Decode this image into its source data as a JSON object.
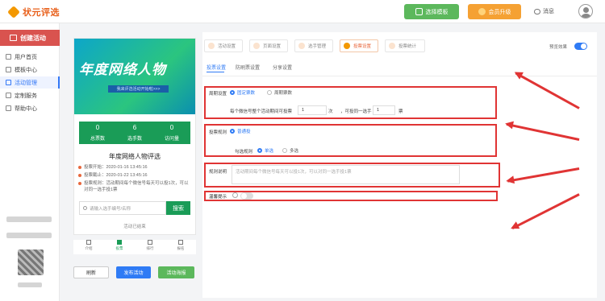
{
  "app": {
    "name": "状元评选"
  },
  "header": {
    "template_btn": "选择模板",
    "vip_btn": "会员升级",
    "messages": "消息"
  },
  "sidebar": {
    "create_btn": "创建活动",
    "items": [
      {
        "label": "用户首页"
      },
      {
        "label": "模板中心"
      },
      {
        "label": "活动管理"
      },
      {
        "label": "定制服务"
      },
      {
        "label": "帮助中心"
      }
    ],
    "active_index": 2
  },
  "phone": {
    "banner_title": "年度网络人物",
    "banner_sub": "我来评选活动开始啦>>>",
    "stats": [
      {
        "value": "0",
        "label": "总票数"
      },
      {
        "value": "6",
        "label": "选手数"
      },
      {
        "value": "0",
        "label": "访问量"
      }
    ],
    "activity_title": "年度网络人物评选",
    "rows": [
      {
        "text": "投票开始：2020-01-16 13:45:16"
      },
      {
        "text": "投票截止：2020-01-22 13:45:16"
      },
      {
        "text": "投票规则：活动期间每个微信号每天可以投1次，可以对同一选手投1票"
      }
    ],
    "search_placeholder": "请输入选手编号/名称",
    "search_btn": "搜索",
    "ended": "活动已结束",
    "tabs": [
      {
        "label": "介绍"
      },
      {
        "label": "投票"
      },
      {
        "label": "排行"
      },
      {
        "label": "报名"
      }
    ],
    "active_tab": 1
  },
  "footer": {
    "btn1": "刷新",
    "btn2": "发布活动",
    "btn3": "活动海报"
  },
  "panel": {
    "steps": [
      {
        "label": "活动设置"
      },
      {
        "label": "页面设置"
      },
      {
        "label": "选手管理"
      },
      {
        "label": "投票设置"
      },
      {
        "label": "投票统计"
      }
    ],
    "active_step": 3,
    "preview_label": "预览效果",
    "preview_on": true,
    "subtabs": [
      {
        "label": "投票设置"
      },
      {
        "label": "防刷票设置"
      },
      {
        "label": "分享设置"
      }
    ],
    "active_subtab": 0,
    "cycle": {
      "label": "周期设置",
      "opt1": "固定票数",
      "opt2": "周期票数",
      "sentence_a": "每个微信号整个活动期间可投票",
      "value1": "1",
      "unit1": "次",
      "sentence_b": "，可投同一选手",
      "value2": "1",
      "unit2": "票"
    },
    "rule": {
      "label": "投票规则",
      "opt1": "普通投",
      "vote_label": "勾选规则",
      "single": "单选",
      "multi": "多选"
    },
    "desc": {
      "label": "规则说明",
      "placeholder": "活动期间每个微信号每天可以投1次，可以对同一选手投1票"
    },
    "alert": {
      "label": "温馨提示",
      "on": false
    }
  },
  "colors": {
    "accent": "#2f7bf5",
    "brand_green": "#1a9c57",
    "annotation_red": "#e03434"
  }
}
